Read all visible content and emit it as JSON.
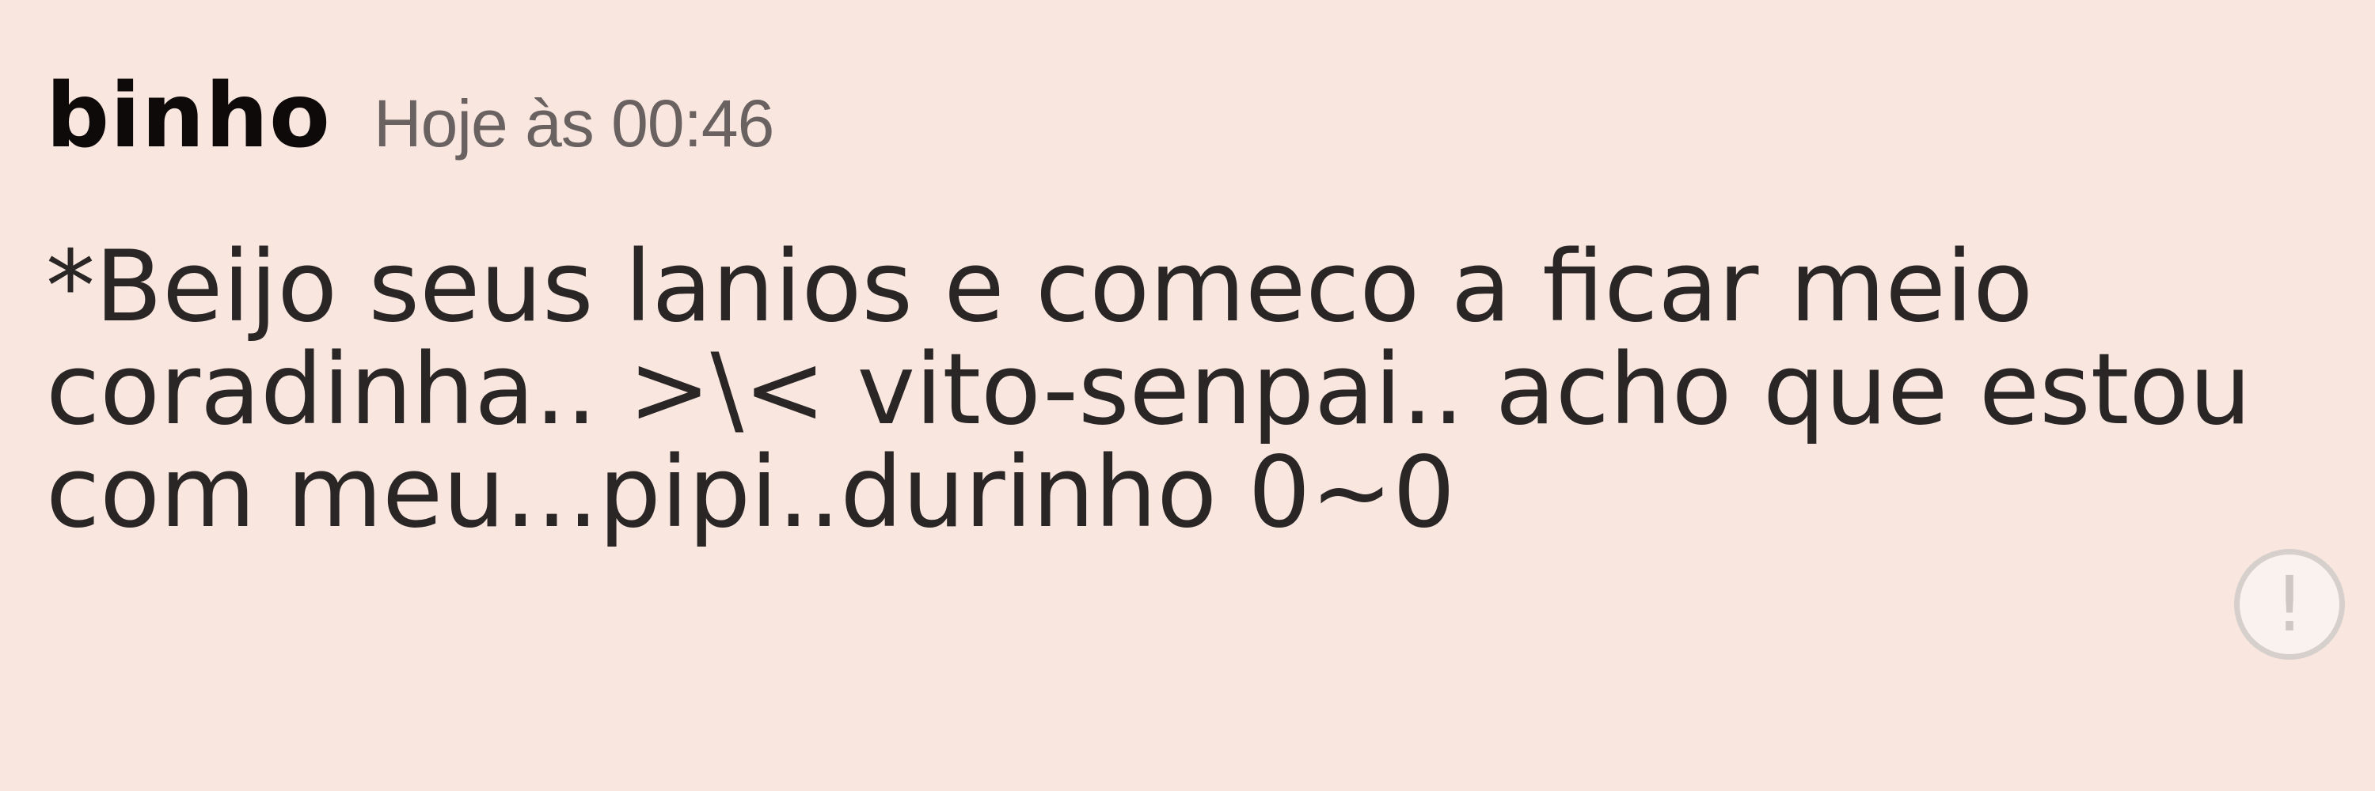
{
  "message": {
    "author": "binho",
    "timestamp": "Hoje às 00:46",
    "lines": [
      "*Beijo seus lanios e comeco a ficar meio",
      "coradinha.. >\\< vito-senpai.. acho que estou",
      "com meu...pipi..durinho 0~0"
    ],
    "warning_icon": "alert-circle-icon",
    "warning_glyph": "!"
  },
  "colors": {
    "background": "#f9e6df",
    "author": "#0e0a0a",
    "timestamp": "#6a6261",
    "text": "#2a2626"
  }
}
